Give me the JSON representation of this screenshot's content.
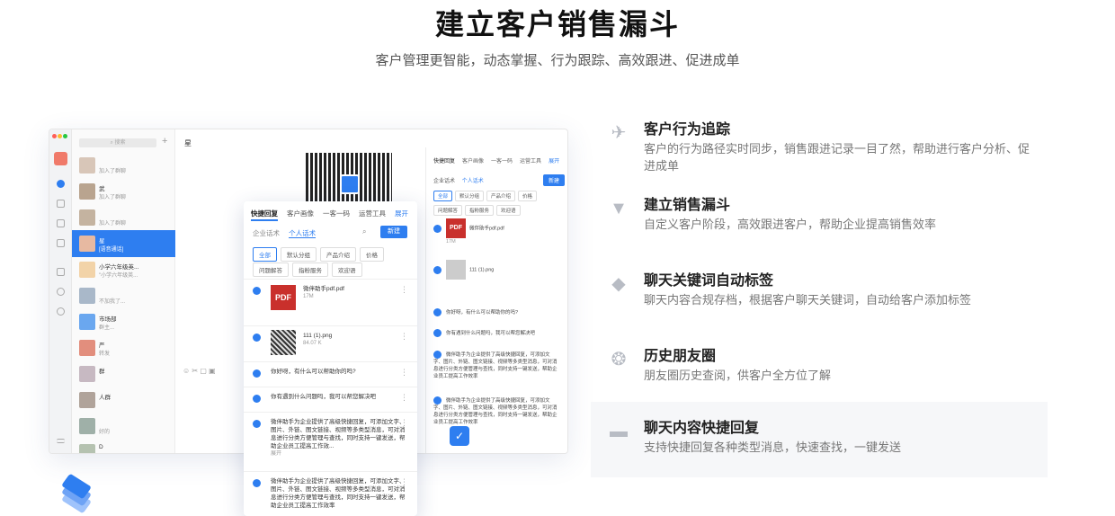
{
  "header": {
    "title": "建立客户销售漏斗",
    "subtitle": "客户管理更智能，动态掌握、行为跟踪、高效跟进、促进成单"
  },
  "app": {
    "search_placeholder": "搜索",
    "plus": "+",
    "chat_title": "星 ",
    "conversations": [
      {
        "name": "",
        "msg": "加入了群聊"
      },
      {
        "name": "武 ",
        "msg": "加入了群聊"
      },
      {
        "name": " ",
        "msg": "加入了群聊"
      },
      {
        "name": "星 ",
        "msg": "[语音通话]"
      },
      {
        "name": "小学六年级英...",
        "msg": "\"小学六年级英..."
      },
      {
        "name": " ",
        "msg": "不加我了..."
      },
      {
        "name": "市场部",
        "msg": "群主..."
      },
      {
        "name": "严 ",
        "msg": "转发"
      },
      {
        "name": " 群",
        "msg": ""
      },
      {
        "name": "人群 ",
        "msg": ""
      },
      {
        "name": " ",
        "msg": "好的"
      },
      {
        "name": "D",
        "msg": ""
      }
    ],
    "toolbar_icons": "☺ ✂ ▢ ▣",
    "side": {
      "tabs": [
        "快捷回复",
        "客户画像",
        "一客一码",
        "运营工具",
        "展开"
      ],
      "sub_tabs": [
        "企业话术",
        "个人话术"
      ],
      "new_label": "新建",
      "chips_row1": [
        "全部",
        "默认分组",
        "产品介绍",
        "价格"
      ],
      "chips_row2": [
        "问题解答",
        "指粉服务",
        "欢迎语"
      ],
      "items": [
        {
          "title": "微伴助手pdf.pdf",
          "size": "17M"
        },
        {
          "title": "111 (1).png",
          "size": ""
        },
        {
          "title": "你好呀，有什么可以帮助你的吗?",
          "size": ""
        },
        {
          "title": "你有遇到什么问题吗，我可以帮您解决吧",
          "size": ""
        },
        {
          "title": "微伴助手为企业提供了高级快捷回复，可添加文字、图片、外链、图文链接、视频等多类型消息，可对消息进行分类方便管理与查找，同时支持一键发送，帮助企业员工提高工作效率",
          "size": ""
        },
        {
          "title": "微伴助手为企业提供了高级快捷回复，可添加文字、图片、外链、图文链接、视频等多类型消息，可对消息进行分类方便管理与查找，同时支持一键发送，帮助企业员工提高工作效率",
          "size": ""
        }
      ]
    },
    "popup": {
      "tabs": [
        "快捷回复",
        "客户画像",
        "一客一码",
        "运营工具",
        "展开"
      ],
      "sub_tabs": [
        "企业话术",
        "个人话术"
      ],
      "new_label": "新建",
      "chips_row1": [
        "全部",
        "默认分组",
        "产品介绍",
        "价格"
      ],
      "chips_row2": [
        "问题解答",
        "指粉服务",
        "欢迎语"
      ],
      "items": [
        {
          "title": "微伴助手pdf.pdf",
          "size": "17M"
        },
        {
          "title": "111 (1).png",
          "size": "84.07 K"
        },
        {
          "title": "你好呀，有什么可以帮助你的吗?",
          "size": ""
        },
        {
          "title": "你有遇到什么问题吗，我可以帮您解决吧",
          "size": ""
        },
        {
          "title": "微伴助手为企业提供了高级快捷回复，可添加文字、图片、外链、图文链接、视频等多类型消息，可对消息进行分类方便管理与查找，同时支持一键发送，帮助企业员工提高工作效...",
          "size": "展开"
        },
        {
          "title": "微伴助手为企业提供了高级快捷回复，可添加文字、图片、外链、图文链接、视频等多类型消息，可对消息进行分类方便管理与查找，同时支持一键发送，帮助企业员工提高工作效率",
          "size": ""
        }
      ],
      "pdf_badge": "PDF"
    }
  },
  "features": [
    {
      "icon": "pin-icon",
      "title": "客户行为追踪",
      "desc": "客户的行为路径实时同步，销售跟进记录一目了然，帮助进行客户分析、促进成单"
    },
    {
      "icon": "funnel-icon",
      "title": "建立销售漏斗",
      "desc": "自定义客户阶段，高效跟进客户，帮助企业提高销售效率"
    },
    {
      "icon": "tag-icon",
      "title": "聊天关键词自动标签",
      "desc": "聊天内容合规存档，根据客户聊天关键词，自动给客户添加标签"
    },
    {
      "icon": "aperture-icon",
      "title": "历史朋友圈",
      "desc": "朋友圈历史查阅，供客户全方位了解"
    },
    {
      "icon": "chat-icon",
      "title": "聊天内容快捷回复",
      "desc": "支持快捷回复各种类型消息，快速查找，一键发送"
    }
  ],
  "colors": {
    "accent": "#2e7ef0",
    "pdf": "#c9302c",
    "highlight_bg": "#f6f7f9"
  }
}
